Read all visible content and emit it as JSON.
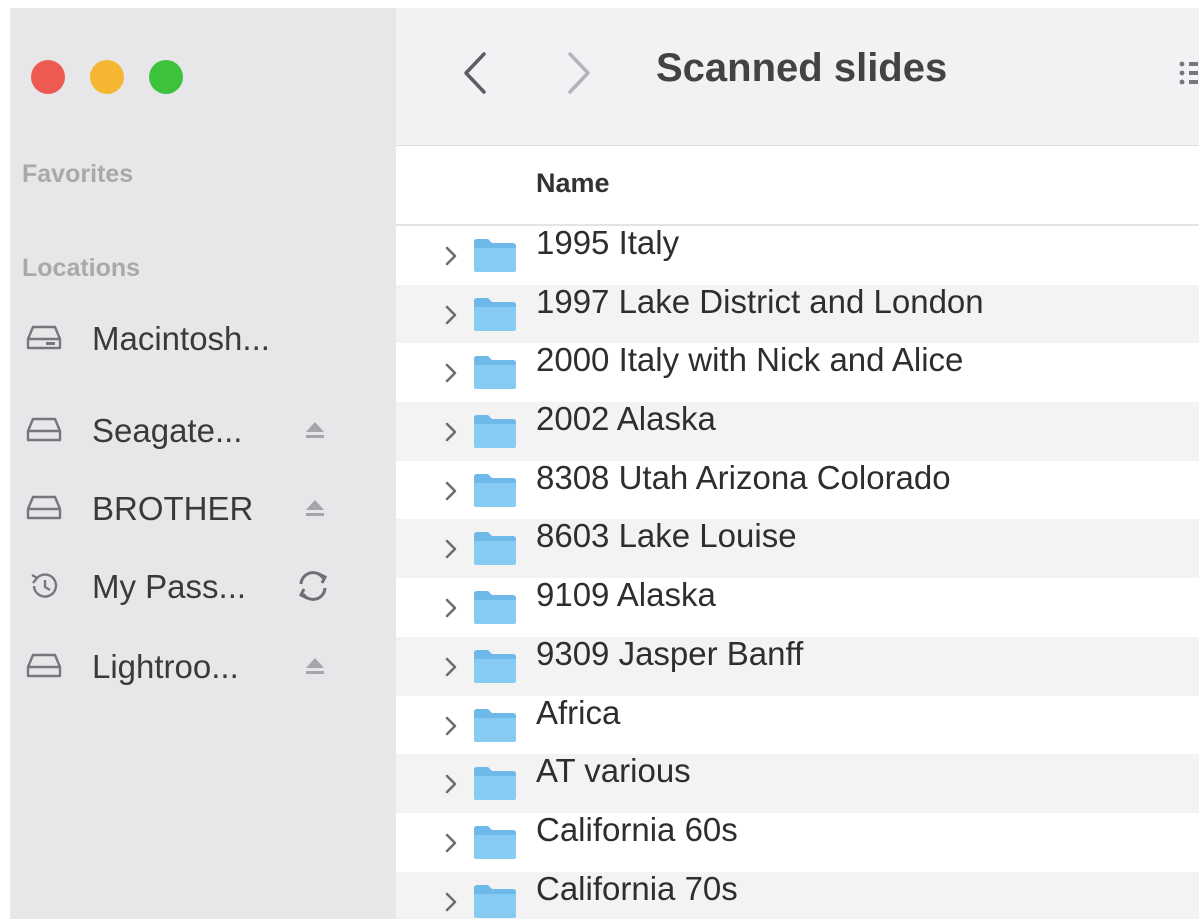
{
  "window": {
    "title": "Scanned slides"
  },
  "sidebar": {
    "favorites_title": "Favorites",
    "locations_title": "Locations",
    "locations": [
      {
        "label": "Macintosh...",
        "icon": "internal-drive-icon",
        "trailing": ""
      },
      {
        "label": "Seagate...",
        "icon": "external-drive-icon",
        "trailing": "eject-icon"
      },
      {
        "label": "BROTHER",
        "icon": "external-drive-icon",
        "trailing": "eject-icon"
      },
      {
        "label": "My Pass...",
        "icon": "time-machine-icon",
        "trailing": "sync-icon"
      },
      {
        "label": "Lightroo...",
        "icon": "external-drive-icon",
        "trailing": "eject-icon"
      }
    ]
  },
  "list": {
    "column_name": "Name",
    "rows": [
      "1995 Italy",
      "1997 Lake District and London",
      "2000 Italy with Nick and Alice",
      "2002 Alaska",
      "8308 Utah Arizona Colorado",
      "8603 Lake Louise",
      "9109 Alaska",
      "9309 Jasper Banff",
      "Africa",
      "AT various",
      "California 60s",
      "California 70s"
    ]
  },
  "colors": {
    "close": "#ee5a52",
    "minimize": "#f5b731",
    "zoom": "#3cc23c",
    "folder": "#7ec3ee",
    "sidebar_bg": "#e7e6e8"
  }
}
